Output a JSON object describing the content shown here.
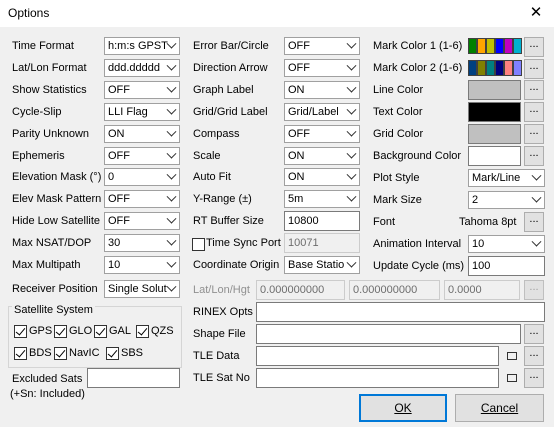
{
  "window": {
    "title": "Options",
    "close_glyph": "✕"
  },
  "col1": [
    {
      "label": "Time Format",
      "value": "h:m:s GPST"
    },
    {
      "label": "Lat/Lon Format",
      "value": "ddd.ddddd"
    },
    {
      "label": "Show Statistics",
      "value": "OFF"
    },
    {
      "label": "Cycle-Slip",
      "value": "LLI Flag"
    },
    {
      "label": "Parity Unknown",
      "value": "ON"
    },
    {
      "label": "Ephemeris",
      "value": "OFF"
    },
    {
      "label": "Elevation Mask (°)",
      "value": "0"
    },
    {
      "label": "Elev Mask Pattern",
      "value": "OFF"
    },
    {
      "label": "Hide Low Satellite",
      "value": "OFF"
    },
    {
      "label": "Max NSAT/DOP",
      "value": "30"
    },
    {
      "label": "Max Multipath",
      "value": "10"
    },
    {
      "label": "Receiver Position",
      "value": "Single Solut"
    }
  ],
  "col2": [
    {
      "label": "Error Bar/Circle",
      "value": "OFF"
    },
    {
      "label": "Direction Arrow",
      "value": "OFF"
    },
    {
      "label": "Graph Label",
      "value": "ON"
    },
    {
      "label": "Grid/Grid Label",
      "value": "Grid/Label"
    },
    {
      "label": "Compass",
      "value": "OFF"
    },
    {
      "label": "Scale",
      "value": "ON"
    },
    {
      "label": "Auto Fit",
      "value": "ON"
    },
    {
      "label": "Y-Range (±)",
      "value": "5m"
    },
    {
      "label": "RT Buffer Size",
      "value": "10800"
    },
    {
      "label": "Time Sync Port",
      "value": "10071"
    },
    {
      "label": "Coordinate Origin",
      "value": "Base Statio"
    }
  ],
  "col3": {
    "mark_color1_label": "Mark Color 1 (1-6)",
    "mark_color2_label": "Mark Color 2 (1-6)",
    "mark_colors1": [
      "#008000",
      "#ffa500",
      "#c0c000",
      "#0000ff",
      "#c000c0",
      "#00b0d0"
    ],
    "mark_colors2": [
      "#004080",
      "#808000",
      "#008080",
      "#000080",
      "#ff8080",
      "#8080ff"
    ],
    "line_color_label": "Line Color",
    "line_color": "#c0c0c0",
    "text_color_label": "Text Color",
    "text_color": "#000000",
    "grid_color_label": "Grid Color",
    "grid_color": "#c0c0c0",
    "bg_color_label": "Background Color",
    "bg_color": "#ffffff",
    "plot_style_label": "Plot Style",
    "plot_style": "Mark/Line",
    "mark_size_label": "Mark Size",
    "mark_size": "2",
    "font_label": "Font",
    "font_value": "Tahoma 8pt",
    "anim_label": "Animation Interval",
    "anim_value": "10",
    "update_label": "Update Cycle (ms)",
    "update_value": "100",
    "dots": "..."
  },
  "latlon": {
    "label": "Lat/Lon/Hgt",
    "lat": "0.000000000",
    "lon": "0.000000000",
    "hgt": "0.0000"
  },
  "satsys": {
    "title": "Satellite System",
    "items": [
      "GPS",
      "GLO",
      "GAL",
      "QZS",
      "BDS",
      "NavIC",
      "SBS"
    ]
  },
  "excluded": {
    "label": "Excluded Sats",
    "note": "(+Sn: Included)",
    "value": ""
  },
  "rinex_label": "RINEX Opts",
  "shape_label": "Shape File",
  "tle_data_label": "TLE Data",
  "tle_sat_label": "TLE Sat No",
  "buttons": {
    "ok": "OK",
    "cancel": "Cancel"
  }
}
